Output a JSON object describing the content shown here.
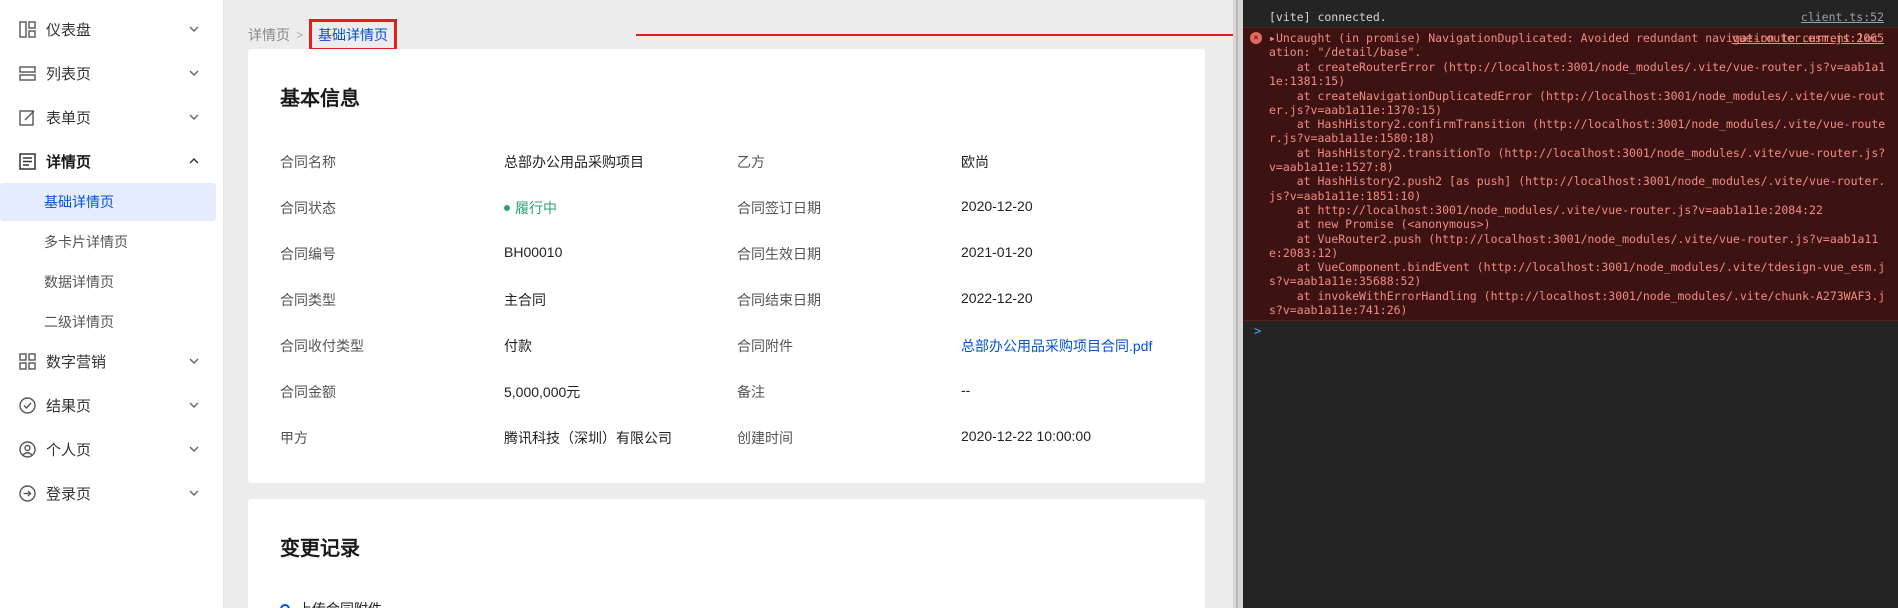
{
  "sidebar": {
    "items": [
      {
        "label": "仪表盘",
        "icon": "dashboard-icon"
      },
      {
        "label": "列表页",
        "icon": "list-icon"
      },
      {
        "label": "表单页",
        "icon": "edit-icon"
      },
      {
        "label": "详情页",
        "icon": "detail-icon"
      },
      {
        "label": "数字营销",
        "icon": "marketing-icon"
      },
      {
        "label": "结果页",
        "icon": "check-circle-icon"
      },
      {
        "label": "个人页",
        "icon": "user-circle-icon"
      },
      {
        "label": "登录页",
        "icon": "login-icon"
      }
    ],
    "sub_items": [
      {
        "label": "基础详情页"
      },
      {
        "label": "多卡片详情页"
      },
      {
        "label": "数据详情页"
      },
      {
        "label": "二级详情页"
      }
    ]
  },
  "breadcrumb": {
    "parent": "详情页",
    "current": "基础详情页",
    "separator": ">"
  },
  "basic_info": {
    "title": "基本信息",
    "fields": [
      {
        "label": "合同名称",
        "value": "总部办公用品采购项目"
      },
      {
        "label": "乙方",
        "value": "欧尚"
      },
      {
        "label": "合同状态",
        "value": "履行中"
      },
      {
        "label": "合同签订日期",
        "value": "2020-12-20"
      },
      {
        "label": "合同编号",
        "value": "BH00010"
      },
      {
        "label": "合同生效日期",
        "value": "2021-01-20"
      },
      {
        "label": "合同类型",
        "value": "主合同"
      },
      {
        "label": "合同结束日期",
        "value": "2022-12-20"
      },
      {
        "label": "合同收付类型",
        "value": "付款"
      },
      {
        "label": "合同附件",
        "value": "总部办公用品采购项目合同.pdf"
      },
      {
        "label": "合同金额",
        "value": "5,000,000元"
      },
      {
        "label": "备注",
        "value": "--"
      },
      {
        "label": "甲方",
        "value": "腾讯科技（深圳）有限公司"
      },
      {
        "label": "创建时间",
        "value": "2020-12-22 10:00:00"
      }
    ]
  },
  "change_log": {
    "title": "变更记录",
    "first_entry": "上传合同附件"
  },
  "console": {
    "vite_connected": "[vite] connected.",
    "vite_src": "client.ts:52",
    "error_src": "vue-router.esm.js:2065",
    "error_message": "Uncaught (in promise) NavigationDuplicated: Avoided redundant navigation to current location: \"/detail/base\".",
    "stack": [
      "    at createRouterError (http://localhost:3001/node_modules/.vite/vue-router.js?v=aab1a11e:1381:15)",
      "    at createNavigationDuplicatedError (http://localhost:3001/node_modules/.vite/vue-router.js?v=aab1a11e:1370:15)",
      "    at HashHistory2.confirmTransition (http://localhost:3001/node_modules/.vite/vue-router.js?v=aab1a11e:1580:18)",
      "    at HashHistory2.transitionTo (http://localhost:3001/node_modules/.vite/vue-router.js?v=aab1a11e:1527:8)",
      "    at HashHistory2.push2 [as push] (http://localhost:3001/node_modules/.vite/vue-router.js?v=aab1a11e:1851:10)",
      "    at http://localhost:3001/node_modules/.vite/vue-router.js?v=aab1a11e:2084:22",
      "    at new Promise (<anonymous>)",
      "    at VueRouter2.push (http://localhost:3001/node_modules/.vite/vue-router.js?v=aab1a11e:2083:12)",
      "    at VueComponent.bindEvent (http://localhost:3001/node_modules/.vite/tdesign-vue_esm.js?v=aab1a11e:35688:52)",
      "    at invokeWithErrorHandling (http://localhost:3001/node_modules/.vite/chunk-A273WAF3.js?v=aab1a11e:741:26)"
    ],
    "prompt": ">"
  },
  "colors": {
    "accent": "#0052d9",
    "status_green": "#2ba471",
    "error_red": "#e02020",
    "console_error_text": "#f28b82"
  }
}
